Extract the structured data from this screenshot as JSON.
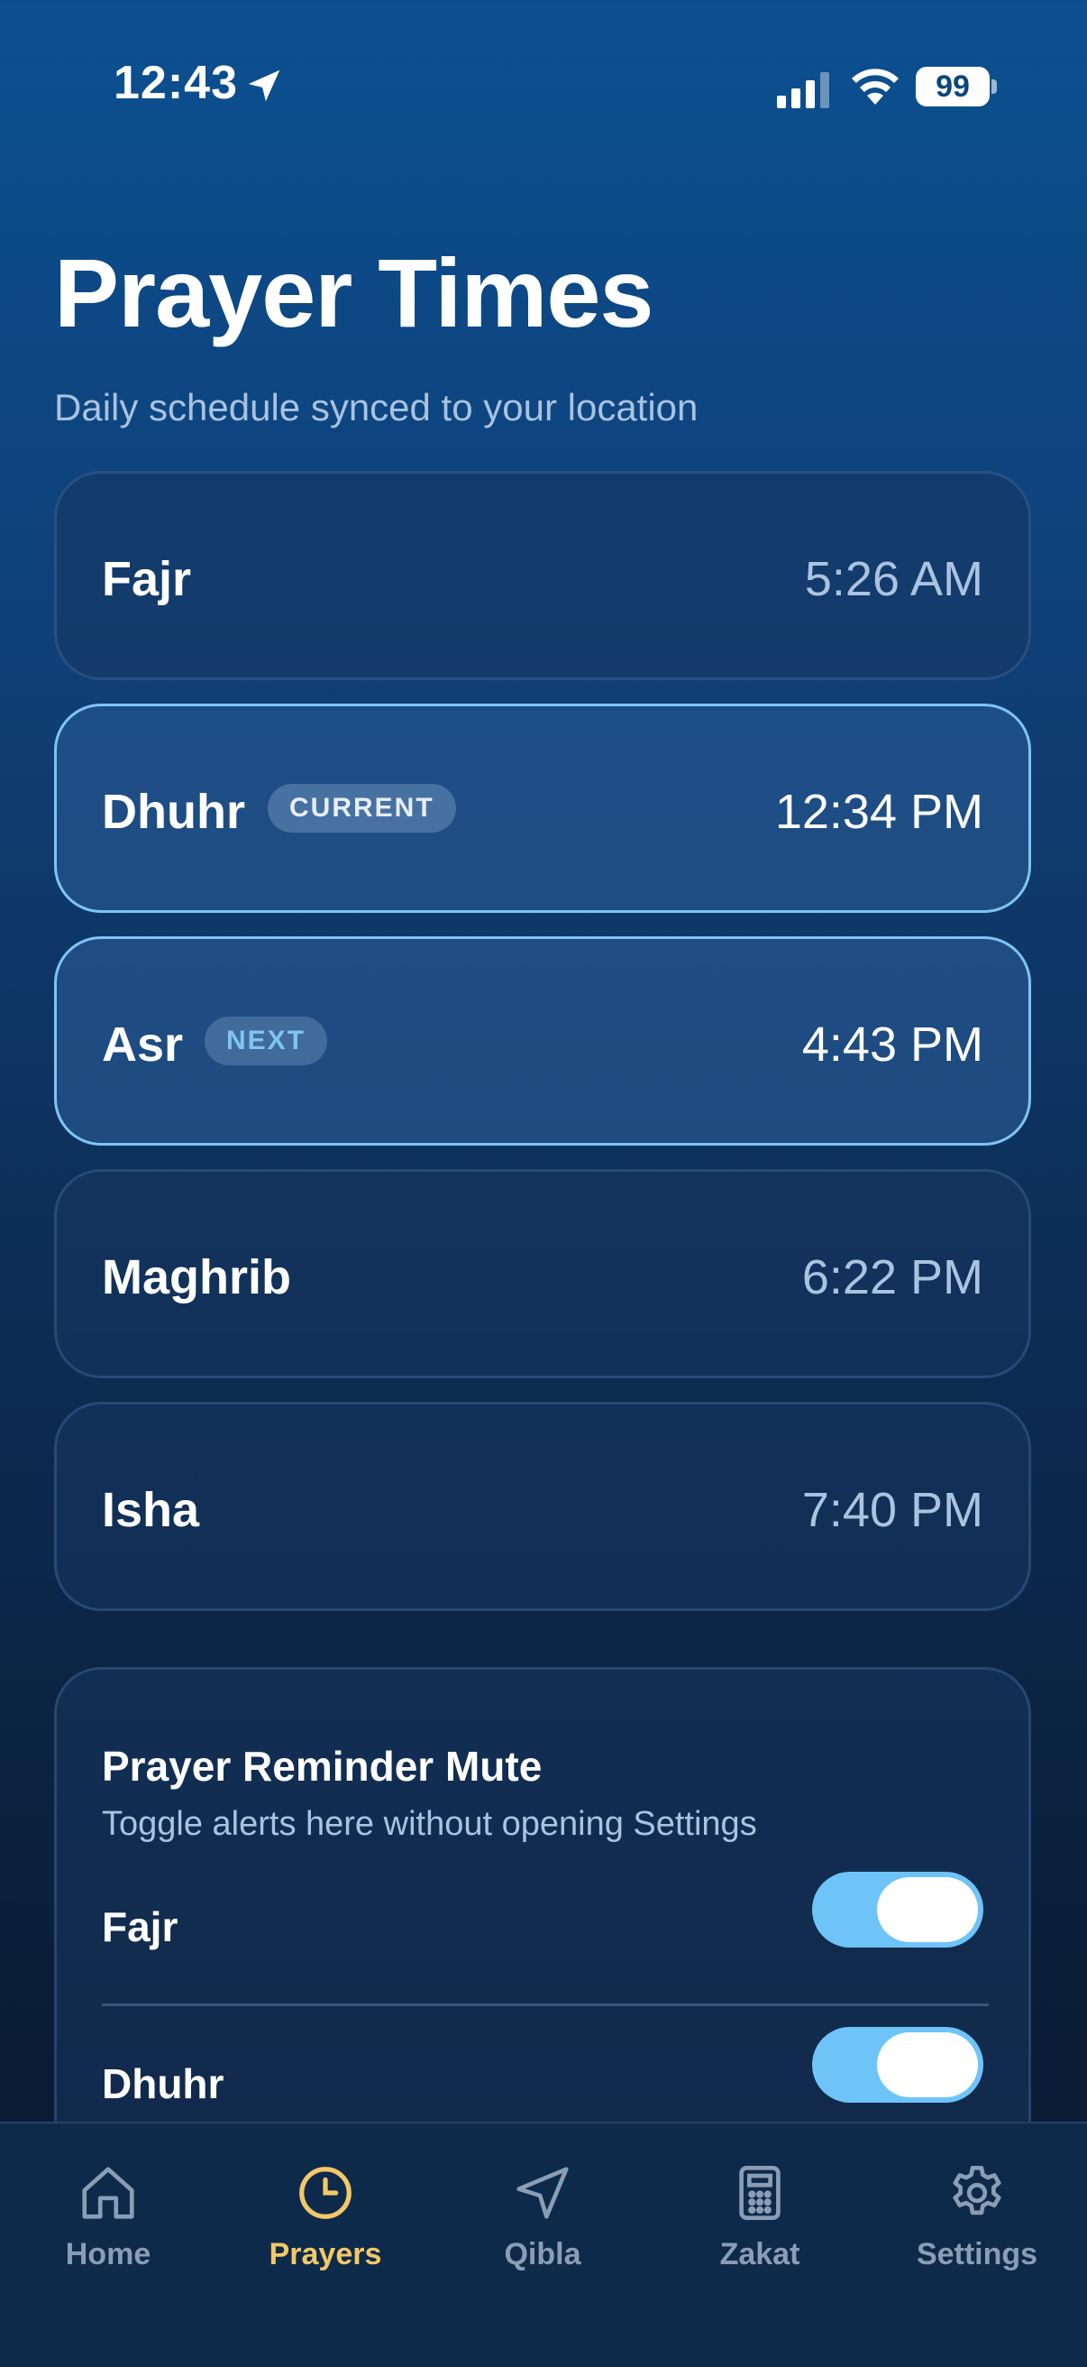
{
  "status_bar": {
    "time": "12:43",
    "battery": "99"
  },
  "page": {
    "title": "Prayer Times",
    "subtitle": "Daily schedule synced to your location"
  },
  "prayers": [
    {
      "name": "Fajr",
      "time": "5:26 AM",
      "badge": ""
    },
    {
      "name": "Dhuhr",
      "time": "12:34 PM",
      "badge": "CURRENT"
    },
    {
      "name": "Asr",
      "time": "4:43 PM",
      "badge": "NEXT"
    },
    {
      "name": "Maghrib",
      "time": "6:22 PM",
      "badge": ""
    },
    {
      "name": "Isha",
      "time": "7:40 PM",
      "badge": ""
    }
  ],
  "reminder_mute": {
    "title": "Prayer Reminder Mute",
    "subtitle": "Toggle alerts here without opening Settings",
    "rows": [
      {
        "label": "Fajr",
        "on": true
      },
      {
        "label": "Dhuhr",
        "on": true
      }
    ]
  },
  "tab_bar": {
    "items": [
      {
        "label": "Home",
        "icon": "house-icon",
        "active": false
      },
      {
        "label": "Prayers",
        "icon": "clock-icon",
        "active": true
      },
      {
        "label": "Qibla",
        "icon": "navigation-arrow-icon",
        "active": false
      },
      {
        "label": "Zakat",
        "icon": "calculator-icon",
        "active": false
      },
      {
        "label": "Settings",
        "icon": "gear-icon",
        "active": false
      }
    ]
  },
  "colors": {
    "accent_active_tab": "#f3c868",
    "highlight_border": "#7fc4f2",
    "toggle_on": "#6ec4f8"
  }
}
